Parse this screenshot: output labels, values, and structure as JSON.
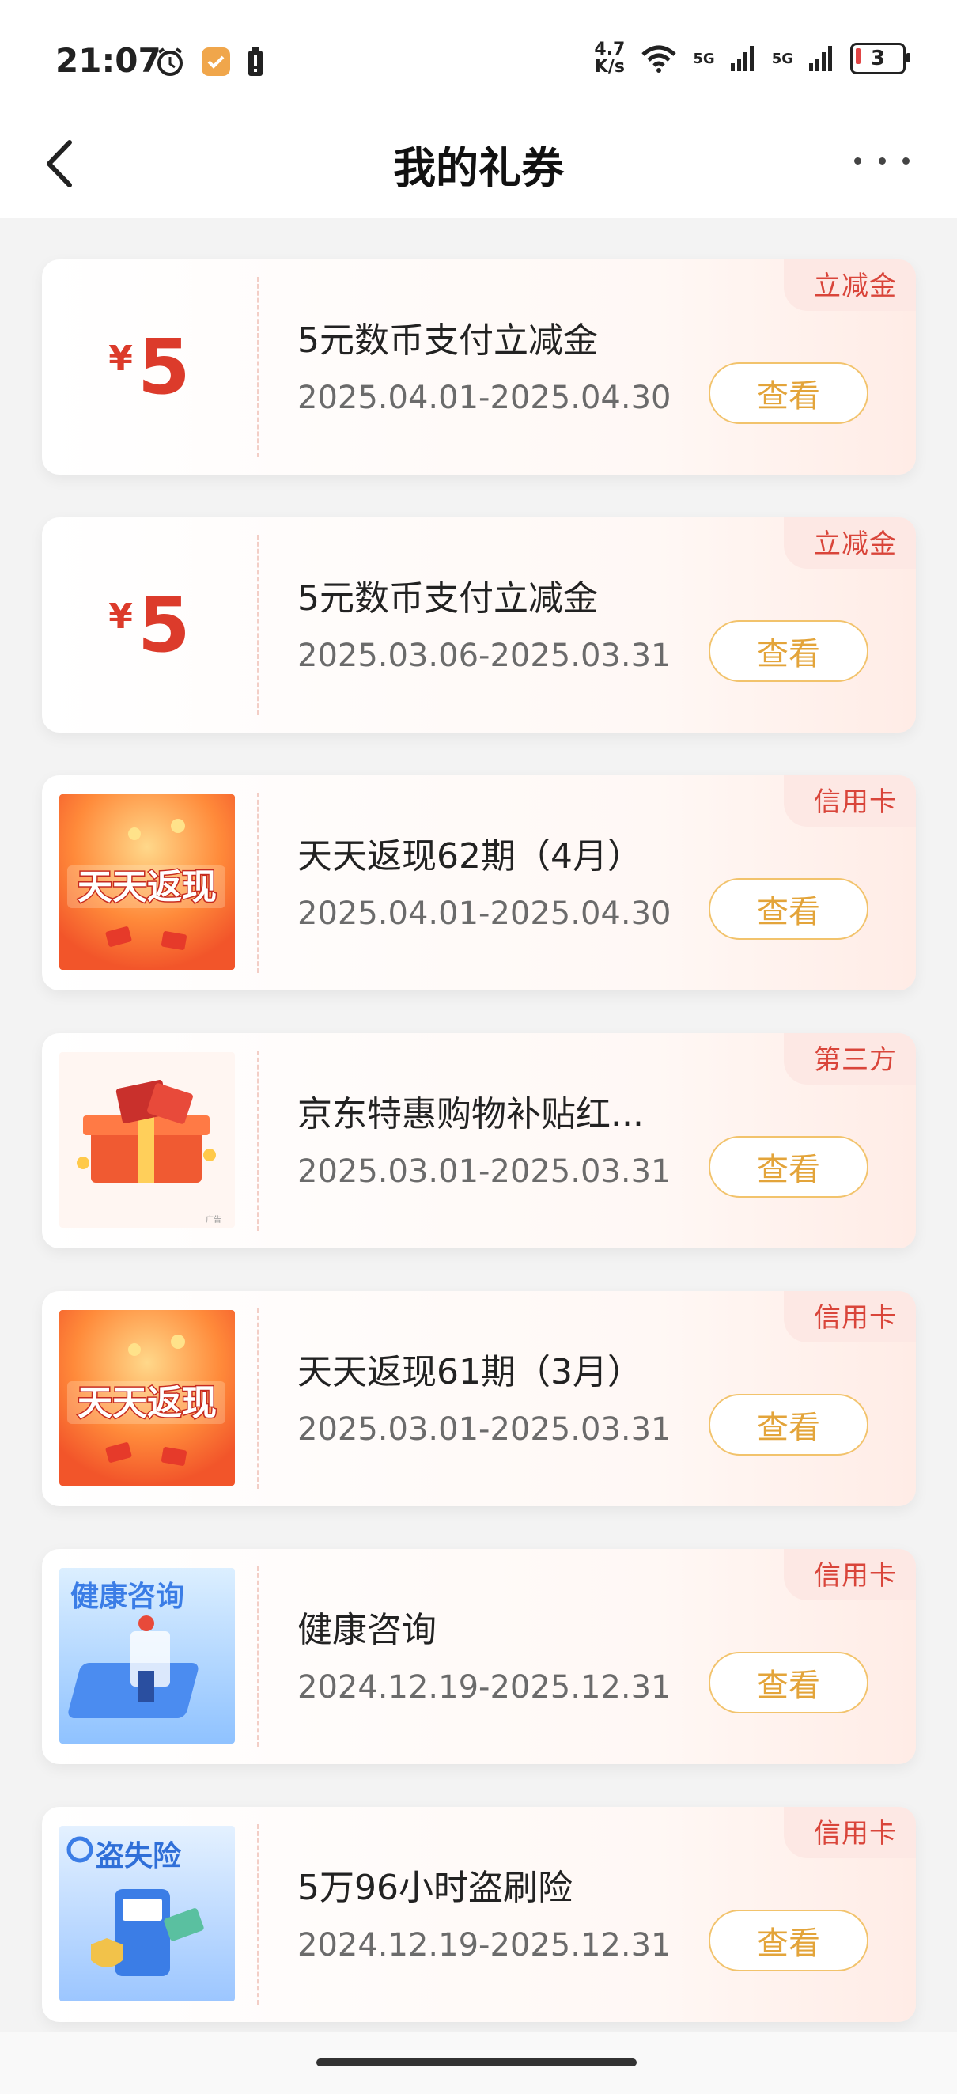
{
  "status": {
    "time": "21:07",
    "net_speed_top": "4.7",
    "net_speed_bottom": "K/s",
    "signal1": "5G",
    "signal2": "5G",
    "battery": "3"
  },
  "header": {
    "title": "我的礼券"
  },
  "coupons": [
    {
      "tag": "立减金",
      "kind": "amount",
      "yen": "¥",
      "amount": "5",
      "title": "5元数币支付立减金",
      "date": "2025.04.01-2025.04.30",
      "button": "查看"
    },
    {
      "tag": "立减金",
      "kind": "amount",
      "yen": "¥",
      "amount": "5",
      "title": "5元数币支付立减金",
      "date": "2025.03.06-2025.03.31",
      "button": "查看"
    },
    {
      "tag": "信用卡",
      "kind": "image",
      "image_text": "天天返现",
      "title": "天天返现62期（4月）",
      "date": "2025.04.01-2025.04.30",
      "button": "查看"
    },
    {
      "tag": "第三方",
      "kind": "image",
      "image_text": "广告",
      "title": "京东特惠购物补贴红...",
      "date": "2025.03.01-2025.03.31",
      "button": "查看"
    },
    {
      "tag": "信用卡",
      "kind": "image",
      "image_text": "天天返现",
      "title": "天天返现61期（3月）",
      "date": "2025.03.01-2025.03.31",
      "button": "查看"
    },
    {
      "tag": "信用卡",
      "kind": "image",
      "image_text": "健康咨询",
      "title": "健康咨询",
      "date": "2024.12.19-2025.12.31",
      "button": "查看"
    },
    {
      "tag": "信用卡",
      "kind": "image",
      "image_text": "盗失险",
      "title": "5万96小时盗刷险",
      "date": "2024.12.19-2025.12.31",
      "button": "查看"
    }
  ],
  "colors": {
    "accent": "#dc3b2b",
    "button": "#e3a43a",
    "tag_bg": "#fde8e4"
  }
}
